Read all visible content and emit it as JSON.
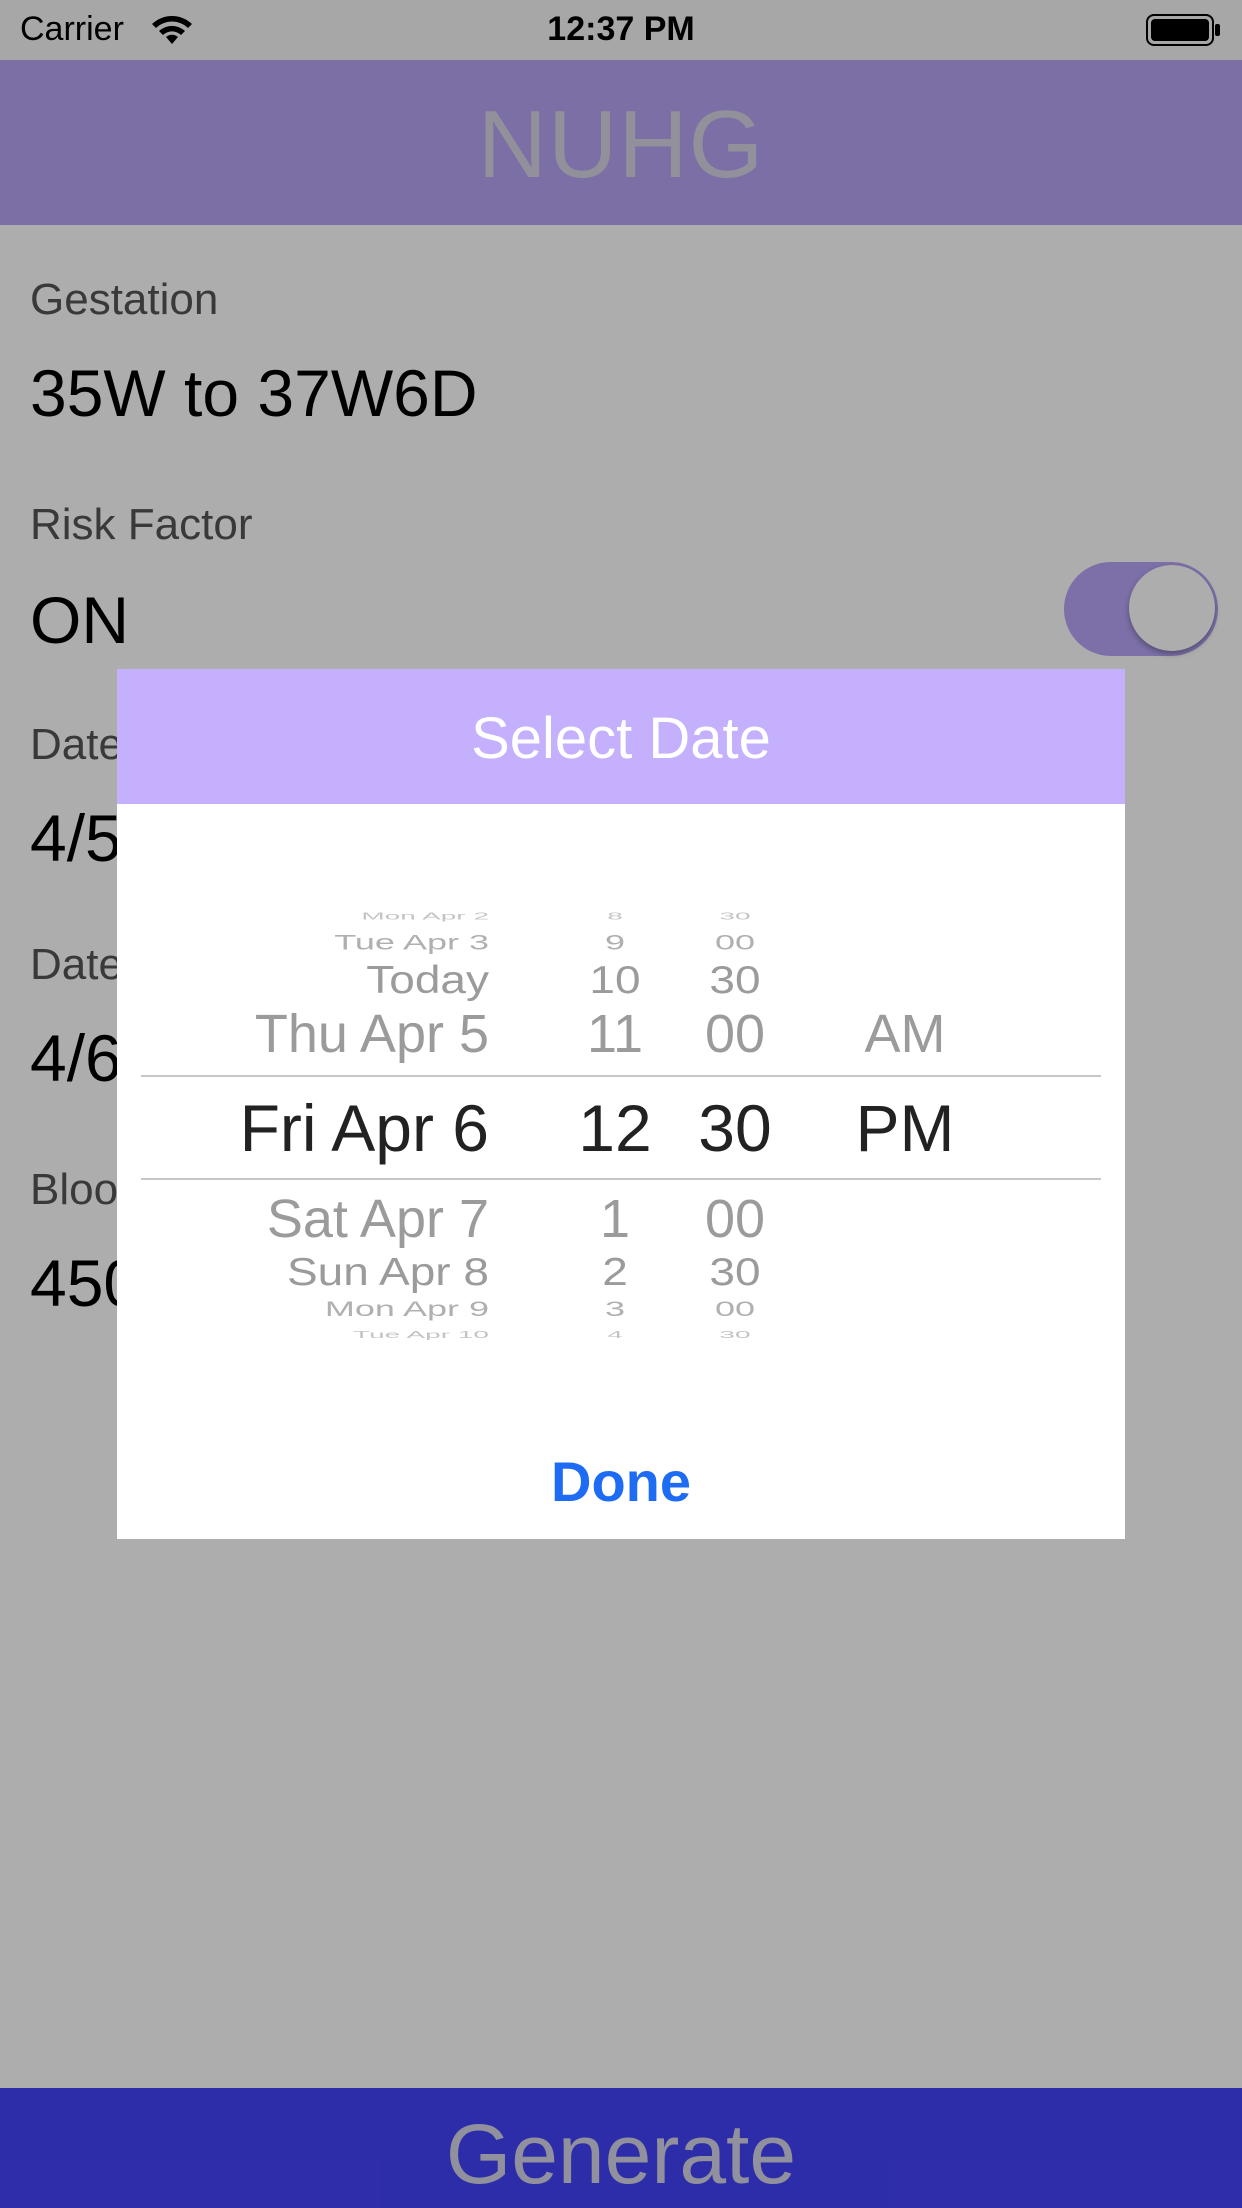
{
  "status_bar": {
    "carrier": "Carrier",
    "time": "12:37 PM"
  },
  "nav": {
    "title": "NUHG"
  },
  "form": {
    "gestation_label": "Gestation",
    "gestation_value": "35W to 37W6D",
    "risk_label": "Risk Factor",
    "risk_value": "ON",
    "risk_toggle_on": true,
    "date1_label": "Date",
    "date1_value": "4/5",
    "date2_label": "Date",
    "date2_value": "4/6",
    "blood_label": "Bloo",
    "blood_value": "450"
  },
  "dialog": {
    "title": "Select Date",
    "done_label": "Done",
    "picker": {
      "days": [
        "Mon Apr 2",
        "Tue Apr 3",
        "Today",
        "Thu Apr 5",
        "Fri Apr 6",
        "Sat Apr 7",
        "Sun Apr 8",
        "Mon Apr 9",
        "Tue Apr 10"
      ],
      "hours": [
        "8",
        "9",
        "10",
        "11",
        "12",
        "1",
        "2",
        "3",
        "4"
      ],
      "minutes": [
        "30",
        "00",
        "30",
        "00",
        "30",
        "00",
        "30",
        "00",
        "30"
      ],
      "ampm": [
        "",
        "",
        "",
        "AM",
        "PM",
        "",
        "",
        "",
        ""
      ],
      "selected": {
        "day": "Fri Apr 6",
        "hour": "12",
        "minute": "30",
        "ampm": "PM"
      }
    }
  },
  "footer": {
    "generate_label": "Generate"
  },
  "colors": {
    "nav_bg": "#b5a4f4",
    "dialog_header_bg": "#c4b0fc",
    "generate_bg": "#4543f9",
    "done_text": "#1f6cf4",
    "toggle_on": "#b8a4f6"
  }
}
